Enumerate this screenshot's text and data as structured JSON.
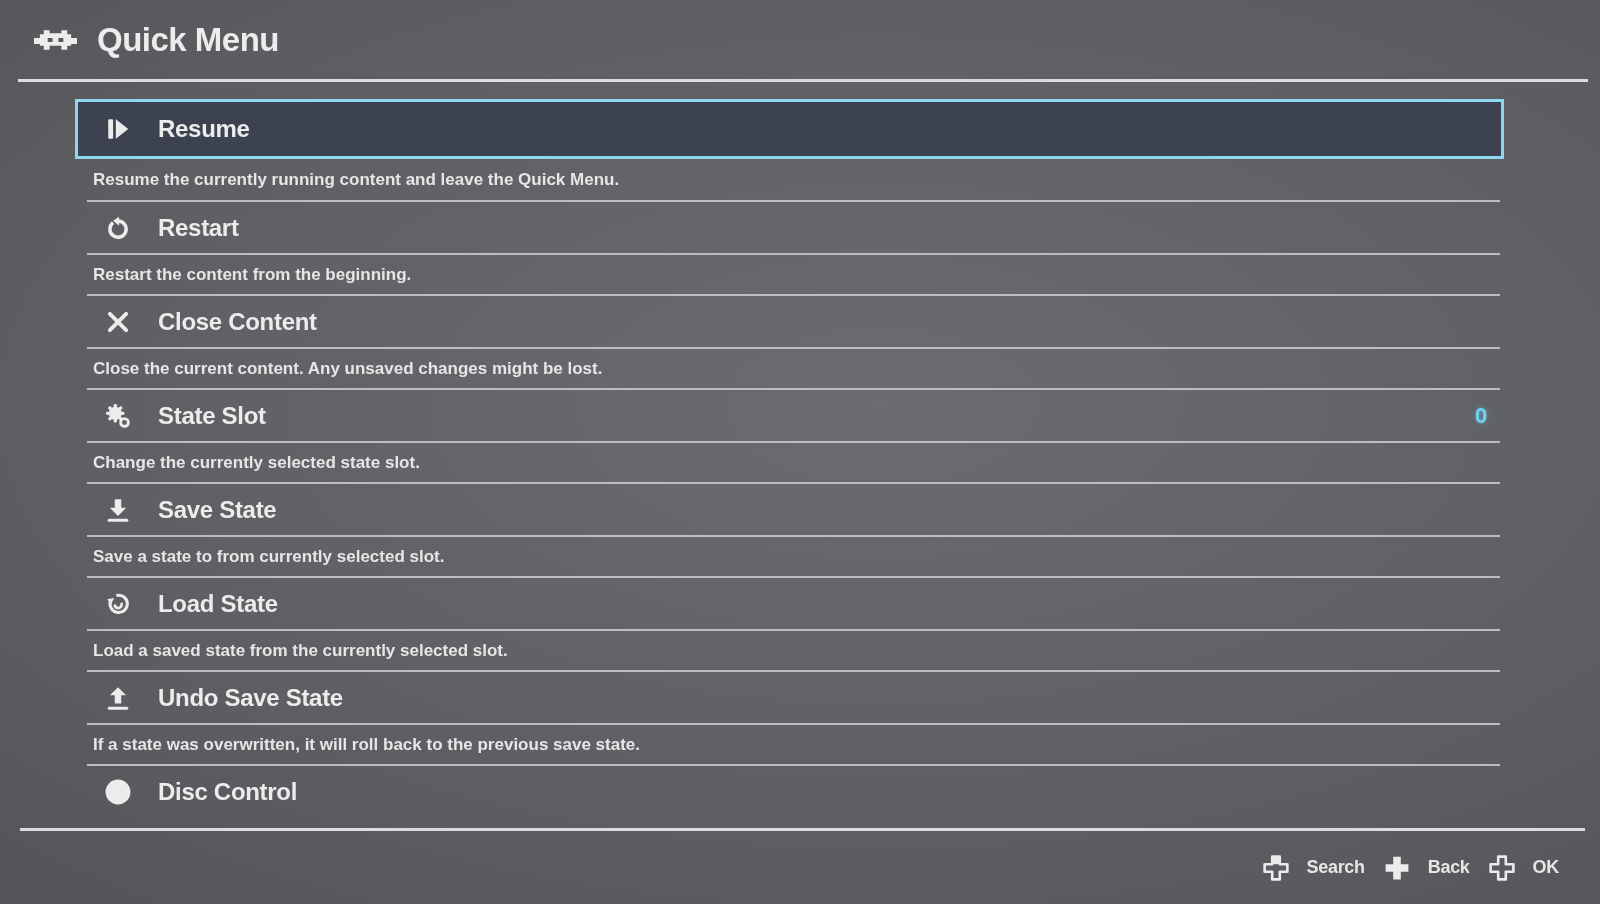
{
  "header": {
    "title": "Quick Menu"
  },
  "items": [
    {
      "label": "Resume",
      "selected": true,
      "description": "Resume the currently running content and leave the Quick Menu."
    },
    {
      "label": "Restart",
      "selected": false,
      "description": "Restart the content from the beginning."
    },
    {
      "label": "Close Content",
      "selected": false,
      "description": "Close the current content. Any unsaved changes might be lost."
    },
    {
      "label": "State Slot",
      "selected": false,
      "value": "0",
      "description": "Change the currently selected state slot."
    },
    {
      "label": "Save State",
      "selected": false,
      "description": "Save a state to from currently selected slot."
    },
    {
      "label": "Load State",
      "selected": false,
      "description": "Load a saved state from the currently selected slot."
    },
    {
      "label": "Undo Save State",
      "selected": false,
      "description": "If a state was overwritten, it will roll back to the previous save state."
    },
    {
      "label": "Disc Control",
      "selected": false
    }
  ],
  "footer": {
    "hints": [
      {
        "label": "Search"
      },
      {
        "label": "Back"
      },
      {
        "label": "OK"
      }
    ]
  }
}
